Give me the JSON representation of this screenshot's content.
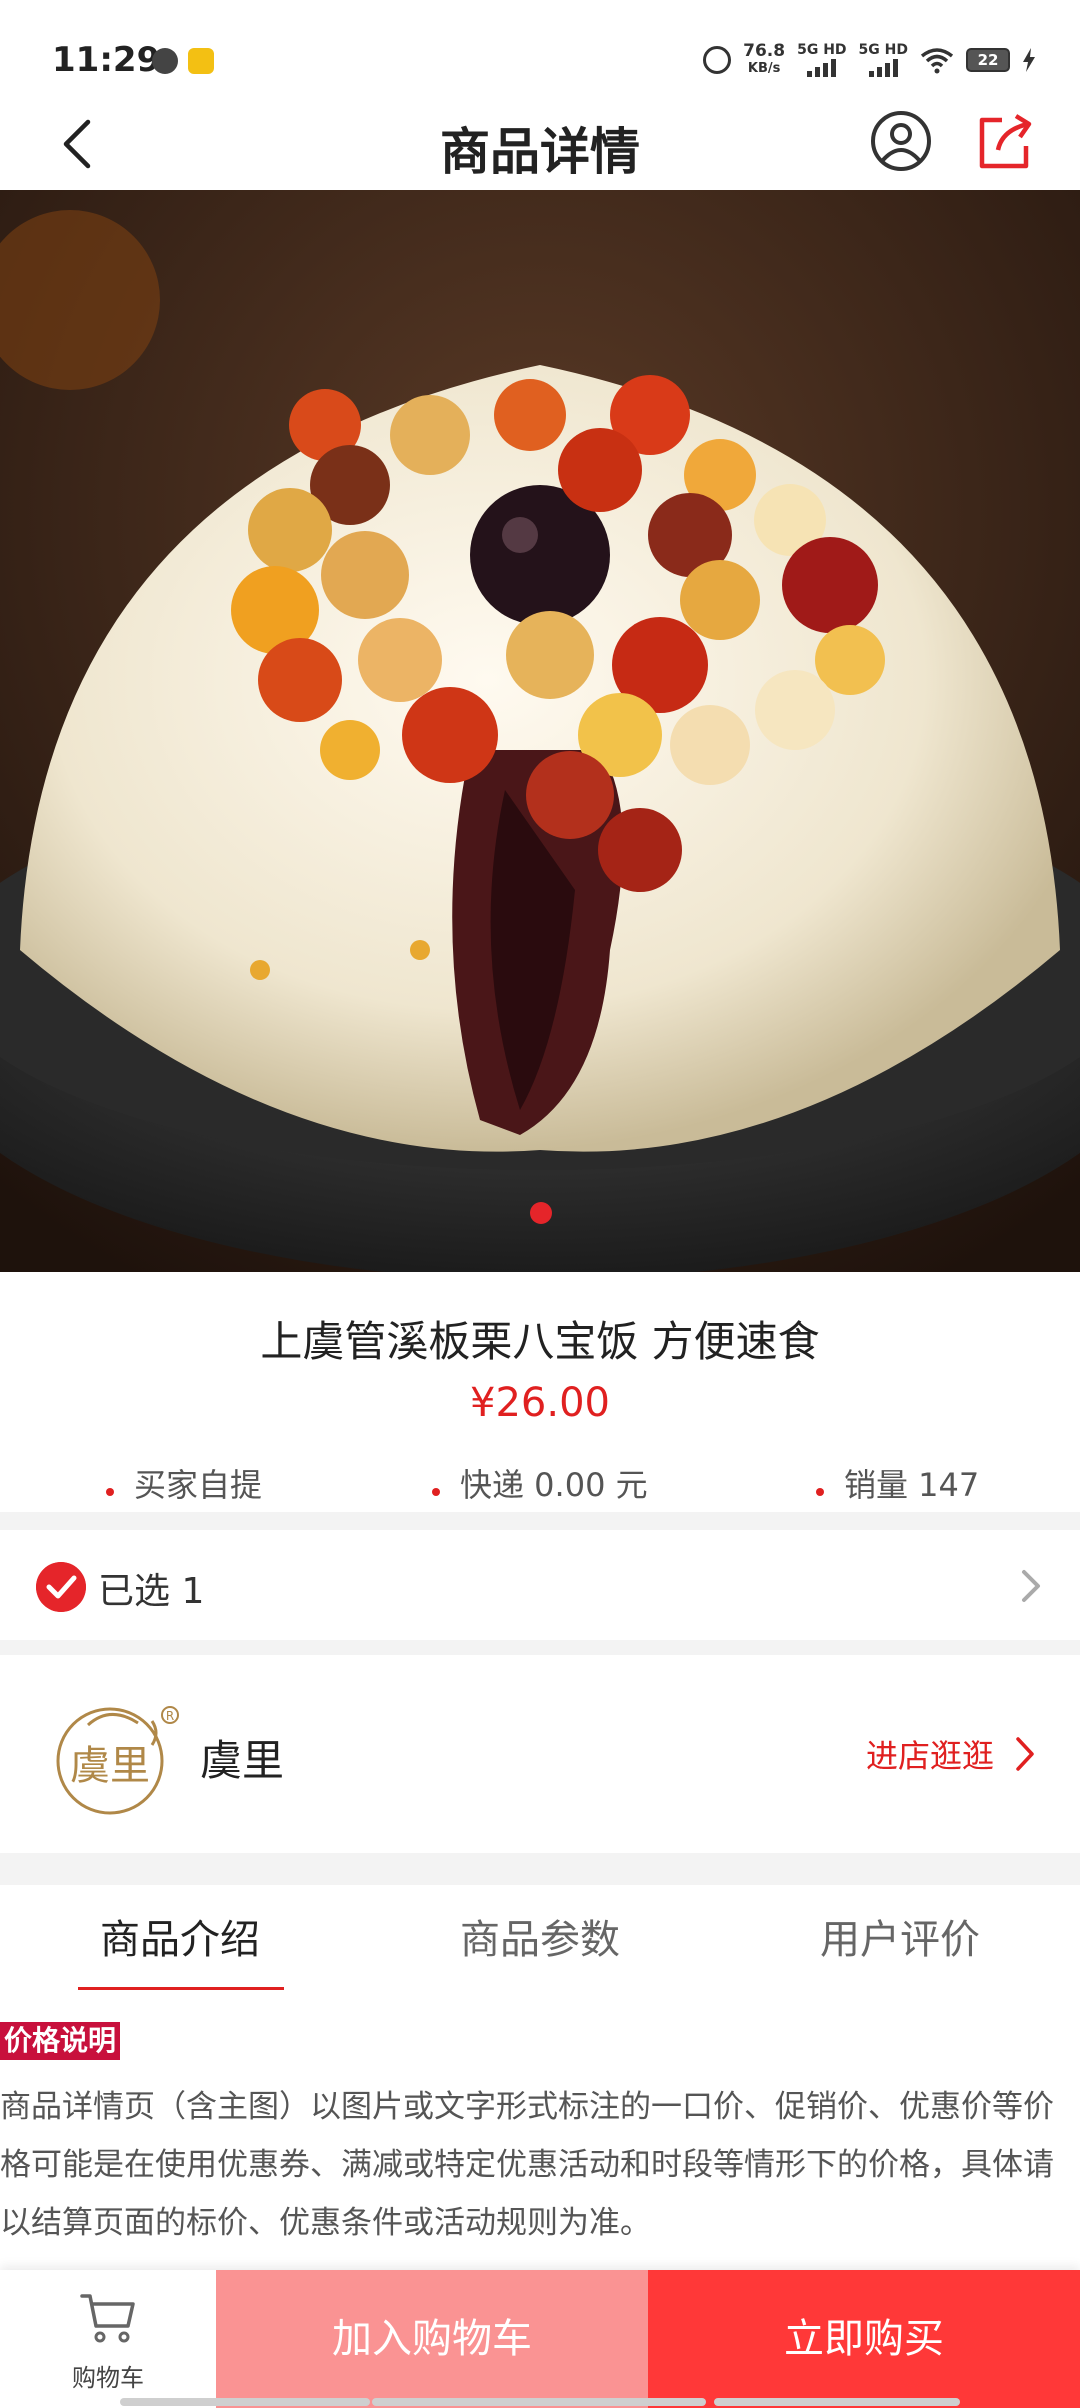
{
  "status_bar": {
    "time": "11:29",
    "net_speed_value": "76.8",
    "net_speed_unit": "KB/s",
    "sim1_label": "5G HD",
    "sim2_label": "5G HD",
    "battery": "22",
    "icons": [
      "globe-icon",
      "app-notification-icon",
      "alarm-icon",
      "signal-icon",
      "wifi-icon",
      "battery-icon",
      "charging-icon"
    ]
  },
  "header": {
    "title": "商品详情",
    "icons": [
      "back-arrow-icon",
      "user-icon",
      "share-icon"
    ]
  },
  "carousel": {
    "dots": 1,
    "active_index": 0,
    "accent_color": "#e5252a"
  },
  "product": {
    "title": "上虞管溪板栗八宝饭 方便速食",
    "price": "¥26.00",
    "meta": {
      "pickup": "买家自提",
      "shipping": "快递  0.00 元",
      "sales": "销量  147"
    }
  },
  "selection": {
    "text": "已选 1"
  },
  "store": {
    "name": "虞里",
    "enter_label": "进店逛逛",
    "logo_text": "虞里"
  },
  "tabs": {
    "items": [
      {
        "label": "商品介绍",
        "active": true
      },
      {
        "label": "商品参数",
        "active": false
      },
      {
        "label": "用户评价",
        "active": false
      }
    ]
  },
  "price_note": {
    "badge": "价格说明",
    "text": "商品详情页（含主图）以图片或文字形式标注的一口价、促销价、优惠价等价格可能是在使用优惠券、满减或特定优惠活动和时段等情形下的价格，具体请以结算页面的标价、优惠条件或活动规则为准。"
  },
  "bottom_bar": {
    "cart_label": "购物车",
    "add_to_cart": "加入购物车",
    "buy_now": "立即购买"
  },
  "colors": {
    "brand_red": "#e02020",
    "add_cart_bg": "#fa9393",
    "buy_bg": "#ff3838"
  }
}
